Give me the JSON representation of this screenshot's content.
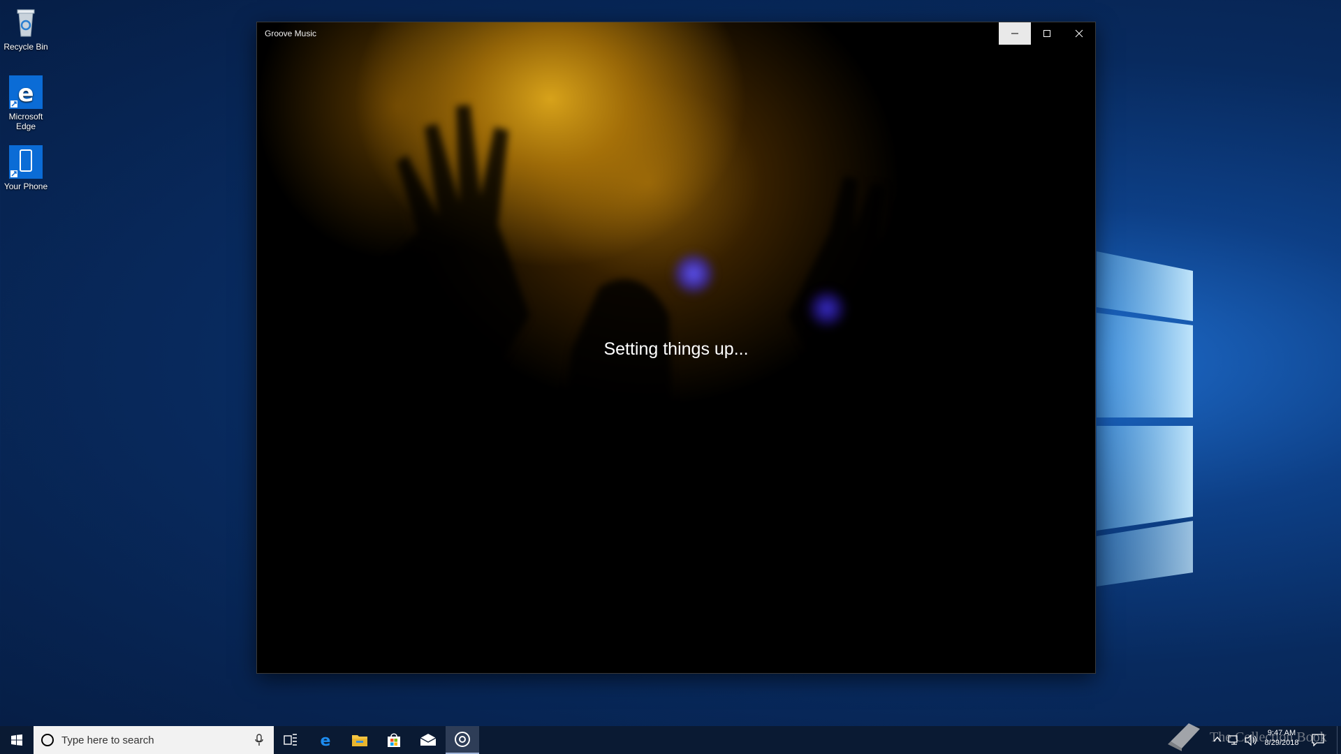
{
  "desktop": {
    "icons": [
      {
        "label": "Recycle Bin",
        "icon": "recycle-bin-icon"
      },
      {
        "label": "Microsoft Edge",
        "icon": "edge-icon"
      },
      {
        "label": "Your Phone",
        "icon": "phone-icon"
      }
    ]
  },
  "window": {
    "title": "Groove Music",
    "status_text": "Setting things up...",
    "caption_buttons": [
      "minimize",
      "maximize",
      "close"
    ]
  },
  "taskbar": {
    "search_placeholder": "Type here to search",
    "pinned": [
      "task-view-icon",
      "edge-icon",
      "file-explorer-icon",
      "store-icon",
      "mail-icon",
      "groove-music-icon"
    ],
    "active_app": "groove-music-icon",
    "clock": {
      "time": "9:47 AM",
      "date": "8/29/2018"
    }
  },
  "watermark": "The Collection Book",
  "colors": {
    "accent": "#0078d7",
    "taskbar": "#0a1a33",
    "window_bg": "#000000"
  }
}
